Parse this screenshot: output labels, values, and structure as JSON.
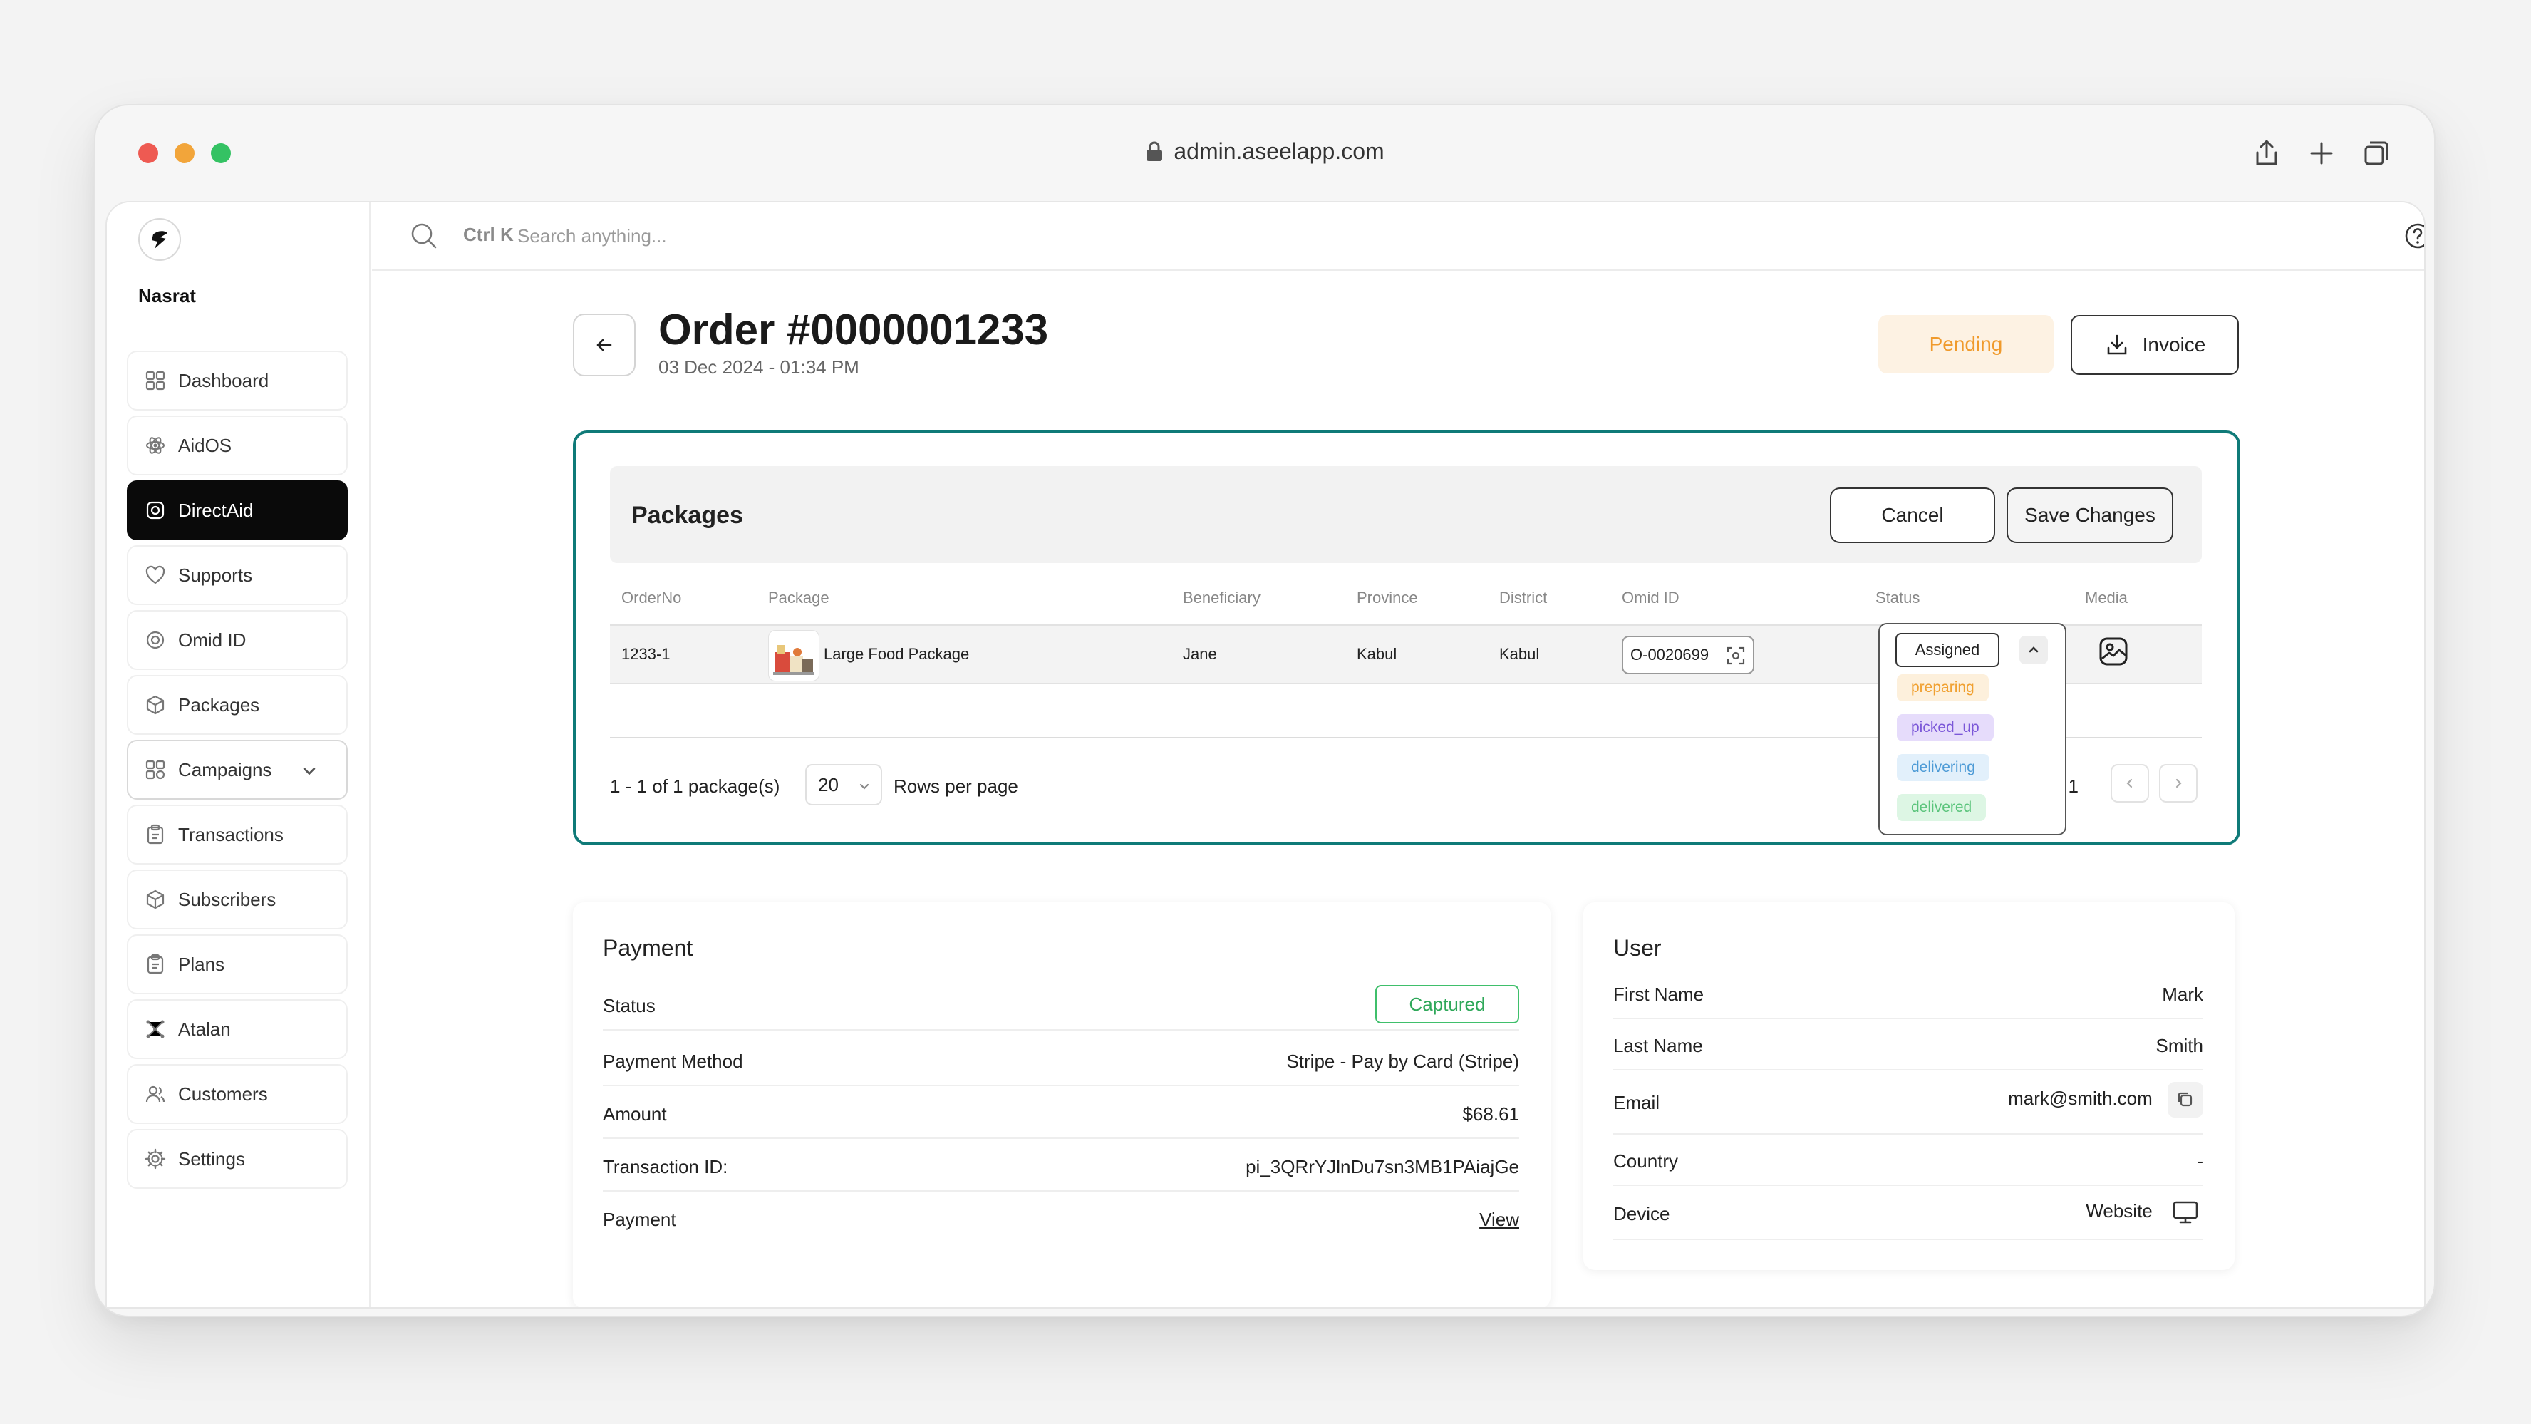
{
  "browser": {
    "url": "admin.aseelapp.com"
  },
  "sidebar": {
    "org_name": "Nasrat",
    "items": [
      {
        "label": "Dashboard",
        "icon": "grid-icon"
      },
      {
        "label": "AidOS",
        "icon": "atom-icon"
      },
      {
        "label": "DirectAid",
        "icon": "direct-aid-icon"
      },
      {
        "label": "Supports",
        "icon": "heart-icon"
      },
      {
        "label": "Omid ID",
        "icon": "id-icon"
      },
      {
        "label": "Packages",
        "icon": "box-icon"
      },
      {
        "label": "Campaigns",
        "icon": "campaigns-icon"
      },
      {
        "label": "Transactions",
        "icon": "clipboard-icon"
      },
      {
        "label": "Subscribers",
        "icon": "box-icon"
      },
      {
        "label": "Plans",
        "icon": "clipboard-icon"
      },
      {
        "label": "Atalan",
        "icon": "network-icon"
      },
      {
        "label": "Customers",
        "icon": "users-icon"
      },
      {
        "label": "Settings",
        "icon": "gear-icon"
      }
    ]
  },
  "topbar": {
    "shortcut": "Ctrl K",
    "search_placeholder": "Search anything..."
  },
  "order": {
    "title": "Order #0000001233",
    "date": "03 Dec 2024 - 01:34 PM",
    "status": "Pending",
    "invoice_label": "Invoice"
  },
  "packages": {
    "title": "Packages",
    "cancel_label": "Cancel",
    "save_label": "Save Changes",
    "columns": [
      "OrderNo",
      "Package",
      "Beneficiary",
      "Province",
      "District",
      "Omid ID",
      "Status",
      "Media"
    ],
    "row": {
      "order_no": "1233-1",
      "package": "Large Food Package",
      "beneficiary": "Jane",
      "province": "Kabul",
      "district": "Kabul",
      "omid_id": "O-0020699",
      "status": "Assigned"
    },
    "status_options": [
      {
        "label": "preparing",
        "bg": "#fdf0dc",
        "fg": "#f0a030"
      },
      {
        "label": "picked_up",
        "bg": "#e6dcfb",
        "fg": "#7b57d8"
      },
      {
        "label": "delivering",
        "bg": "#e2f0fb",
        "fg": "#4d9bd6"
      },
      {
        "label": "delivered",
        "bg": "#ddf6e4",
        "fg": "#5bc47c"
      }
    ],
    "pagination": {
      "summary": "1 - 1 of 1 package(s)",
      "rows_per_page": "20",
      "rows_label": "Rows per page",
      "page_of": "f 1"
    }
  },
  "payment": {
    "title": "Payment",
    "fields": [
      {
        "key": "Status",
        "value": "Captured"
      },
      {
        "key": "Payment Method",
        "value": "Stripe - Pay by Card (Stripe)"
      },
      {
        "key": "Amount",
        "value": "$68.61"
      },
      {
        "key": "Transaction ID:",
        "value": "pi_3QRrYJlnDu7sn3MB1PAiajGe"
      },
      {
        "key": "Payment",
        "value": "View"
      }
    ]
  },
  "user": {
    "title": "User",
    "fields": [
      {
        "key": "First Name",
        "value": "Mark"
      },
      {
        "key": "Last Name",
        "value": "Smith"
      },
      {
        "key": "Email",
        "value": "mark@smith.com"
      },
      {
        "key": "Country",
        "value": "-"
      },
      {
        "key": "Device",
        "value": "Website"
      }
    ]
  },
  "colors": {
    "accent": "#0f7a78",
    "pending_bg": "#fdf2e3",
    "pending_fg": "#f09a2b",
    "captured": "#3fbf6b"
  }
}
